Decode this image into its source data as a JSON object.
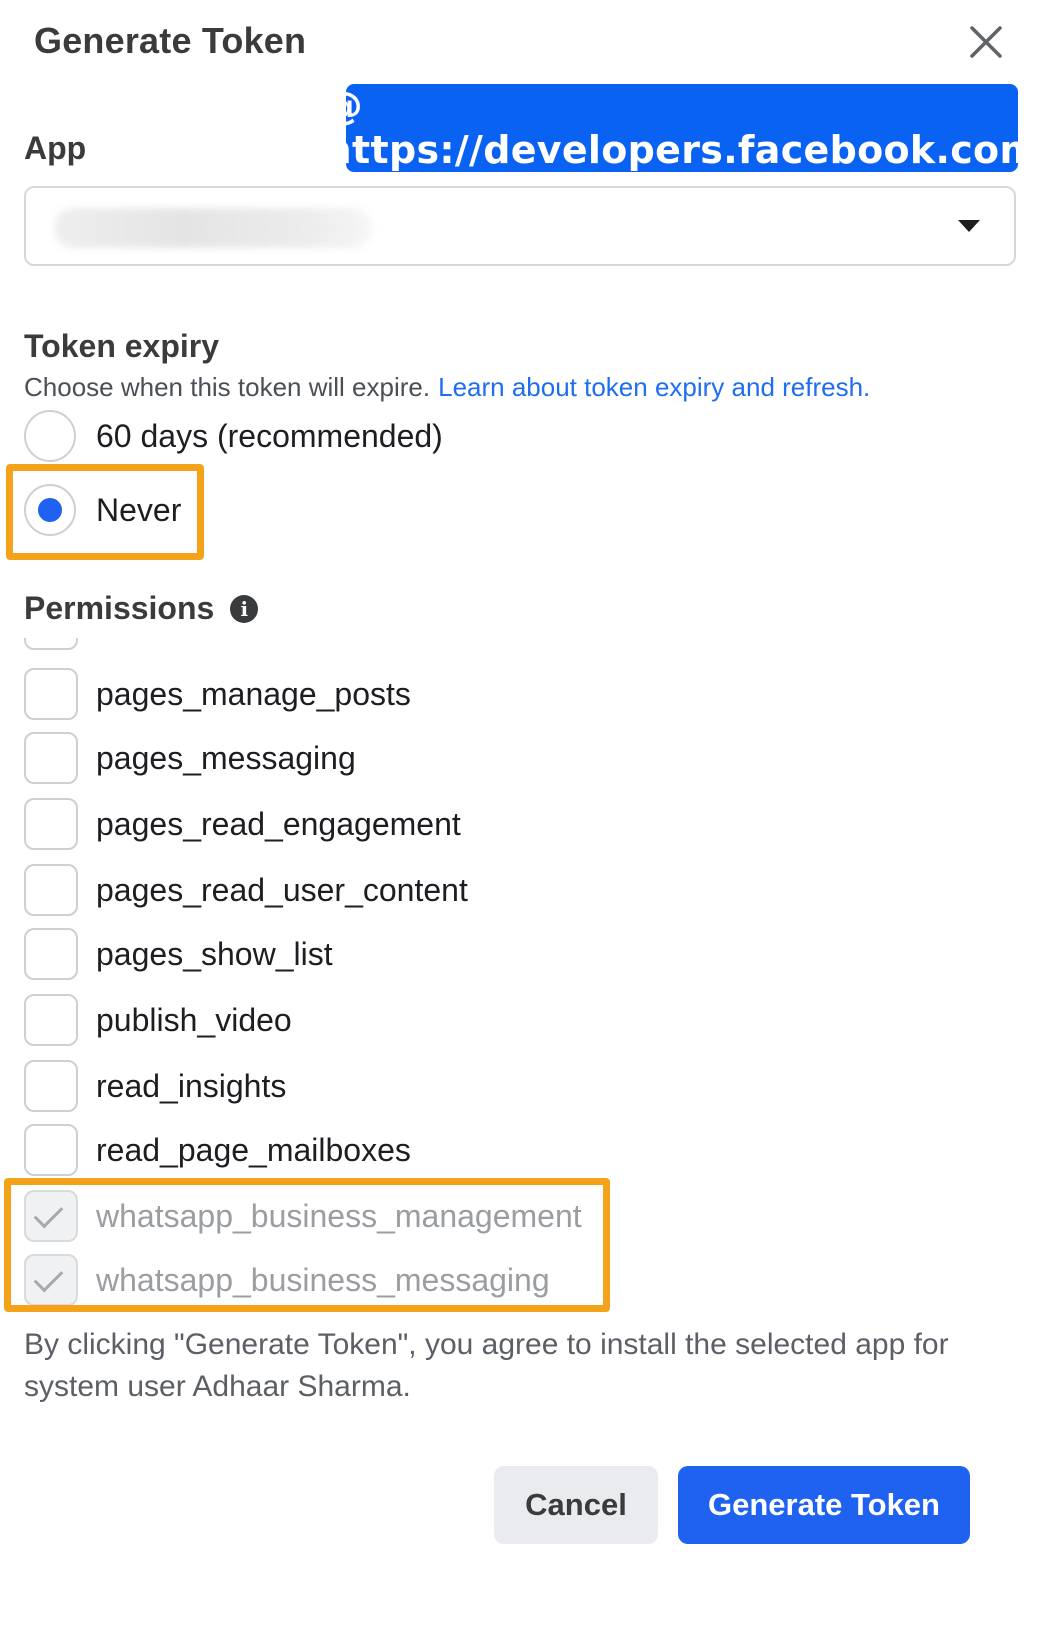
{
  "dialog": {
    "title": "Generate Token",
    "close_icon": "close-icon"
  },
  "banner": {
    "text": "@ https://developers.facebook.com"
  },
  "app_field": {
    "label": "App",
    "value": "",
    "caret_icon": "caret-down-icon"
  },
  "token_expiry": {
    "label": "Token expiry",
    "description": "Choose when this token will expire.",
    "link_text": "Learn about token expiry and refresh.",
    "options": [
      {
        "label": "60 days (recommended)",
        "selected": false
      },
      {
        "label": "Never",
        "selected": true
      }
    ]
  },
  "permissions": {
    "label": "Permissions",
    "info_icon": "info-icon",
    "items": [
      {
        "label": "pages_manage_posts",
        "checked": false,
        "disabled": false
      },
      {
        "label": "pages_messaging",
        "checked": false,
        "disabled": false
      },
      {
        "label": "pages_read_engagement",
        "checked": false,
        "disabled": false
      },
      {
        "label": "pages_read_user_content",
        "checked": false,
        "disabled": false
      },
      {
        "label": "pages_show_list",
        "checked": false,
        "disabled": false
      },
      {
        "label": "publish_video",
        "checked": false,
        "disabled": false
      },
      {
        "label": "read_insights",
        "checked": false,
        "disabled": false
      },
      {
        "label": "read_page_mailboxes",
        "checked": false,
        "disabled": false
      },
      {
        "label": "whatsapp_business_management",
        "checked": true,
        "disabled": true
      },
      {
        "label": "whatsapp_business_messaging",
        "checked": true,
        "disabled": true
      }
    ]
  },
  "agreement": {
    "text": "By clicking \"Generate Token\", you agree to install the selected app for system user Adhaar Sharma."
  },
  "actions": {
    "cancel_label": "Cancel",
    "generate_label": "Generate Token"
  },
  "colors": {
    "accent": "#1f62f0",
    "banner": "#0a62f2",
    "highlight": "#f5a21b"
  }
}
